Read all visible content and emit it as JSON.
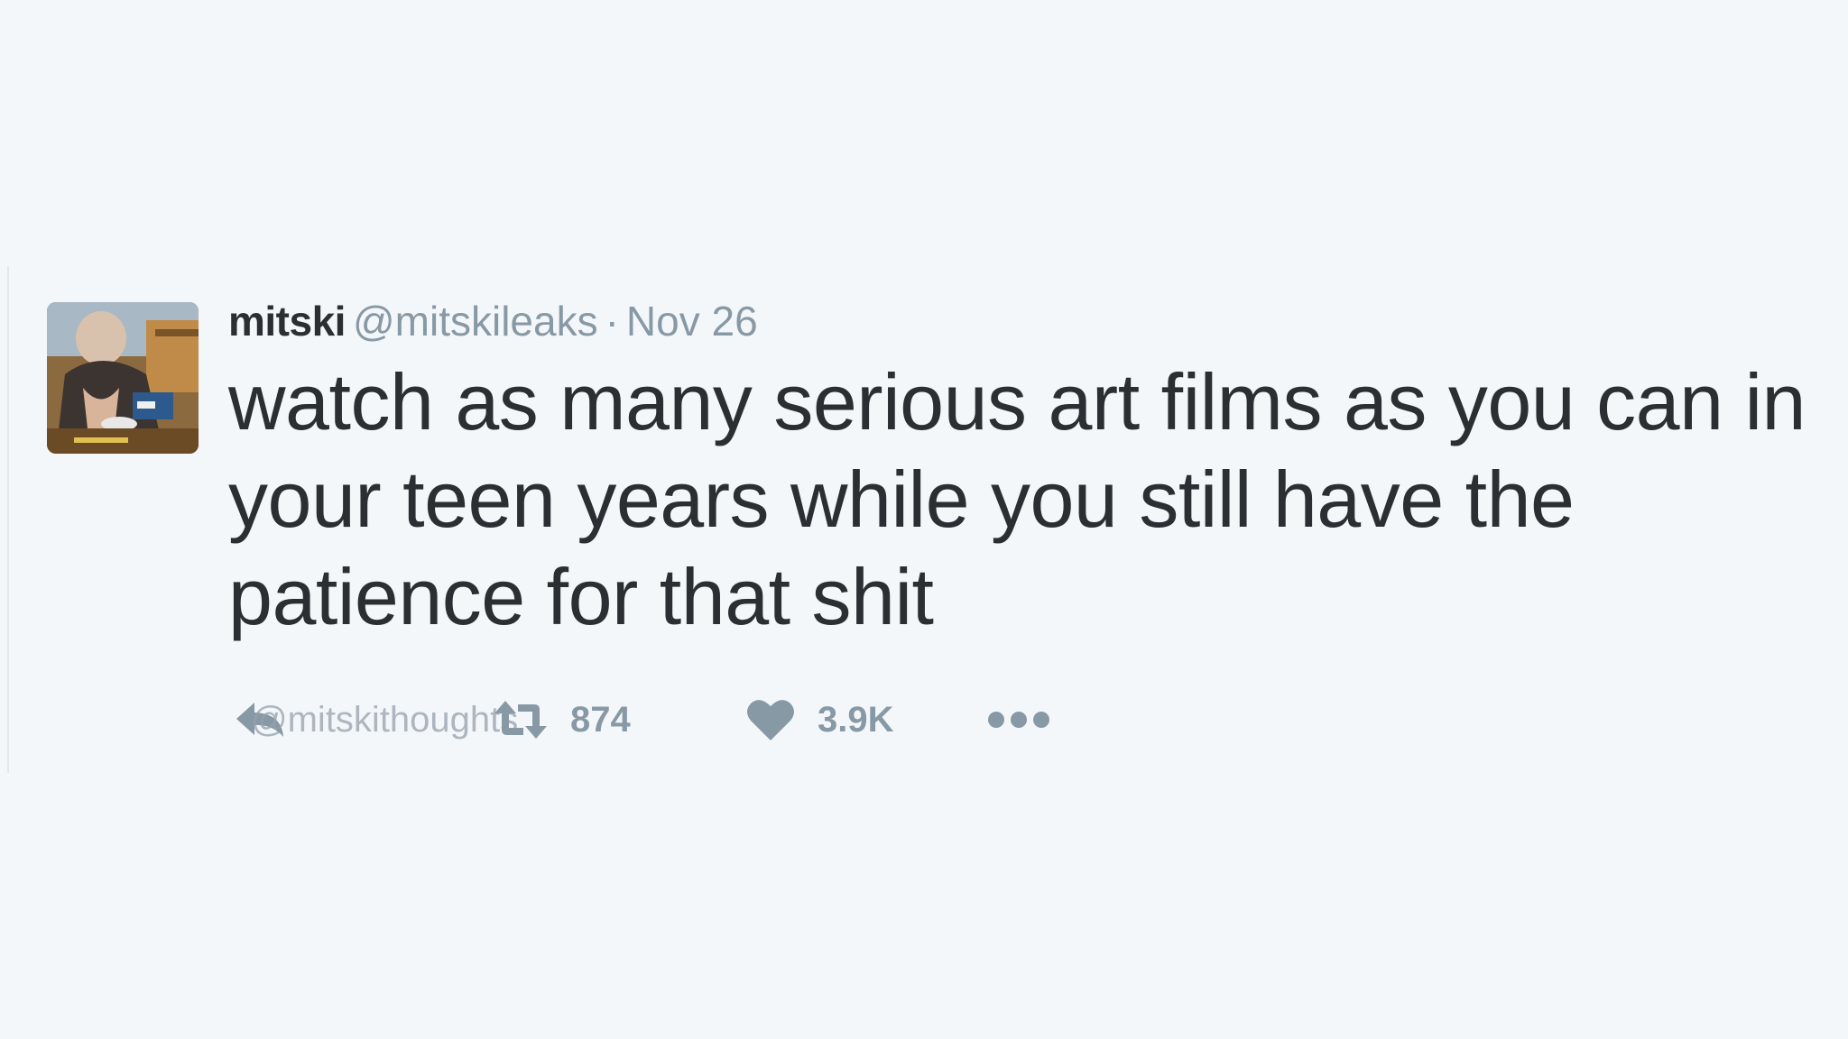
{
  "tweet": {
    "display_name": "mitski",
    "handle": "@mitskileaks",
    "separator": "·",
    "timestamp": "Nov 26",
    "text": "watch as many serious art films as you can in your teen years while you still have the patience for that shit"
  },
  "actions": {
    "reply_icon": "reply-icon",
    "retweet_icon": "retweet-icon",
    "retweet_count": "874",
    "like_icon": "heart-icon",
    "like_count": "3.9K",
    "more_icon": "more-dots-icon"
  },
  "watermark": "@mitskithoughts",
  "colors": {
    "background": "#f4f7fa",
    "text": "#2b2f33",
    "muted": "#8899a6"
  }
}
